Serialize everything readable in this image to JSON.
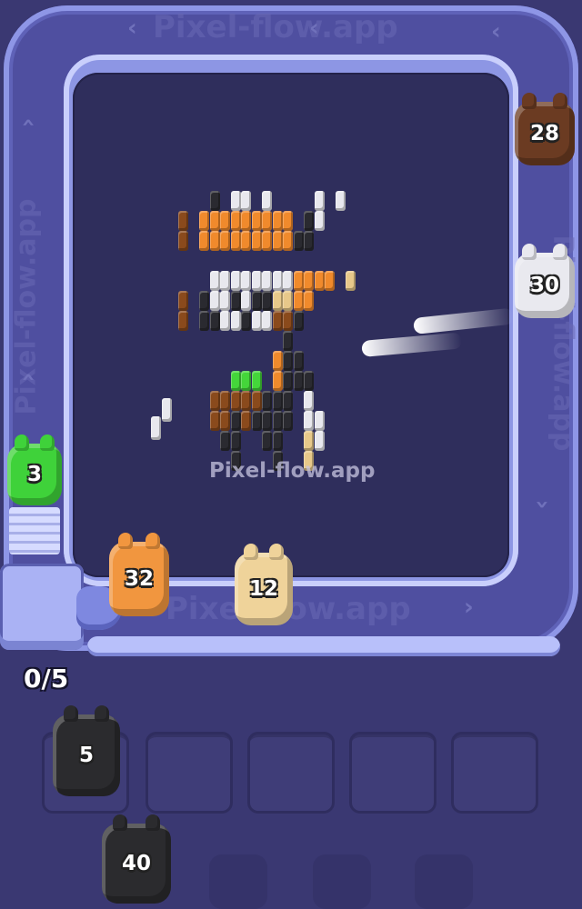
{
  "watermark": {
    "text": "Pixel-flow.app"
  },
  "progress": {
    "text": "0/5",
    "filled": 0,
    "total": 5
  },
  "shooters": {
    "green": {
      "count": "3",
      "color": "#3fd23a"
    },
    "brown": {
      "count": "28",
      "color": "#6b3b22"
    },
    "white": {
      "count": "30",
      "color": "#e9e9ef"
    },
    "orange": {
      "count": "32",
      "color": "#f1963f"
    },
    "tan": {
      "count": "12",
      "color": "#efd39a"
    },
    "black_slot": {
      "count": "5",
      "color": "#2b2b2e"
    },
    "black_queue": {
      "count": "40",
      "color": "#2b2b2e"
    }
  },
  "slots": {
    "count": 5,
    "occupied": 1
  },
  "colors": {
    "background": "#3a3872",
    "board": "#2f2e5c",
    "belt": "#8d96e4"
  }
}
